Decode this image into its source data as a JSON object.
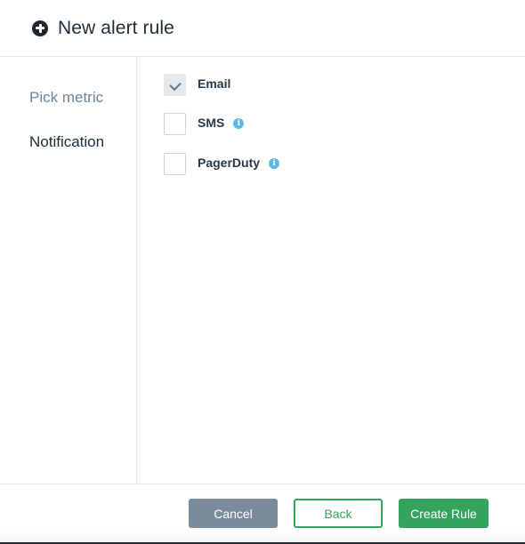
{
  "header": {
    "icon": "plus-circle-icon",
    "title": "New alert rule"
  },
  "sidebar": {
    "steps": [
      {
        "label": "Pick metric",
        "state": "inactive"
      },
      {
        "label": "Notification",
        "state": "active"
      }
    ]
  },
  "notifications": {
    "options": [
      {
        "label": "Email",
        "checked": true,
        "info_icon": false
      },
      {
        "label": "SMS",
        "checked": false,
        "info_icon": true
      },
      {
        "label": "PagerDuty",
        "checked": false,
        "info_icon": true
      }
    ],
    "info_glyph": "i"
  },
  "footer": {
    "cancel_label": "Cancel",
    "back_label": "Back",
    "create_label": "Create Rule"
  },
  "colors": {
    "primary_green": "#34a35d",
    "cancel_gray": "#7a8b9b",
    "info_blue": "#5bb8e5",
    "inactive_step": "#6f8496"
  }
}
